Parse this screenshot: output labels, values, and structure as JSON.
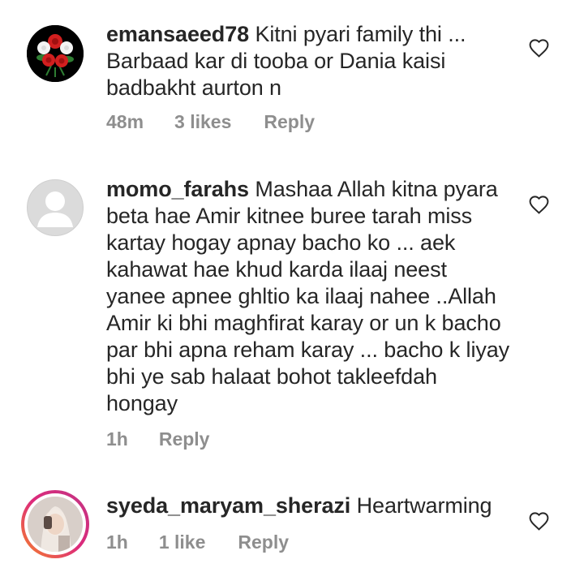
{
  "comments": [
    {
      "username": "emansaeed78",
      "text": "Kitni pyari family thi ... Barbaad kar di tooba or Dania kaisi badbakht aurton n",
      "time": "48m",
      "likes": "3 likes",
      "reply_label": "Reply",
      "avatar_icon": "roses-avatar"
    },
    {
      "username": "momo_farahs",
      "text": "Mashaa Allah kitna pyara beta hae Amir kitnee buree tarah miss kartay hogay apnay bacho ko ... aek kahawat hae khud karda ilaaj neest yanee apnee ghltio ka ilaaj nahee ..Allah Amir ki bhi maghfirat karay or un k bacho par bhi apna reham karay ... bacho k liyay bhi ye sab halaat bohot takleefdah hongay",
      "time": "1h",
      "likes": "",
      "reply_label": "Reply",
      "avatar_icon": "default-user-avatar"
    },
    {
      "username": "syeda_maryam_sherazi",
      "text": "Heartwarming",
      "time": "1h",
      "likes": "1 like",
      "reply_label": "Reply",
      "avatar_icon": "story-ring-photo-avatar"
    }
  ],
  "colors": {
    "text": "#262626",
    "meta": "#8e8e8e",
    "story_ring_start": "#f58529",
    "story_ring_end": "#c13584"
  }
}
